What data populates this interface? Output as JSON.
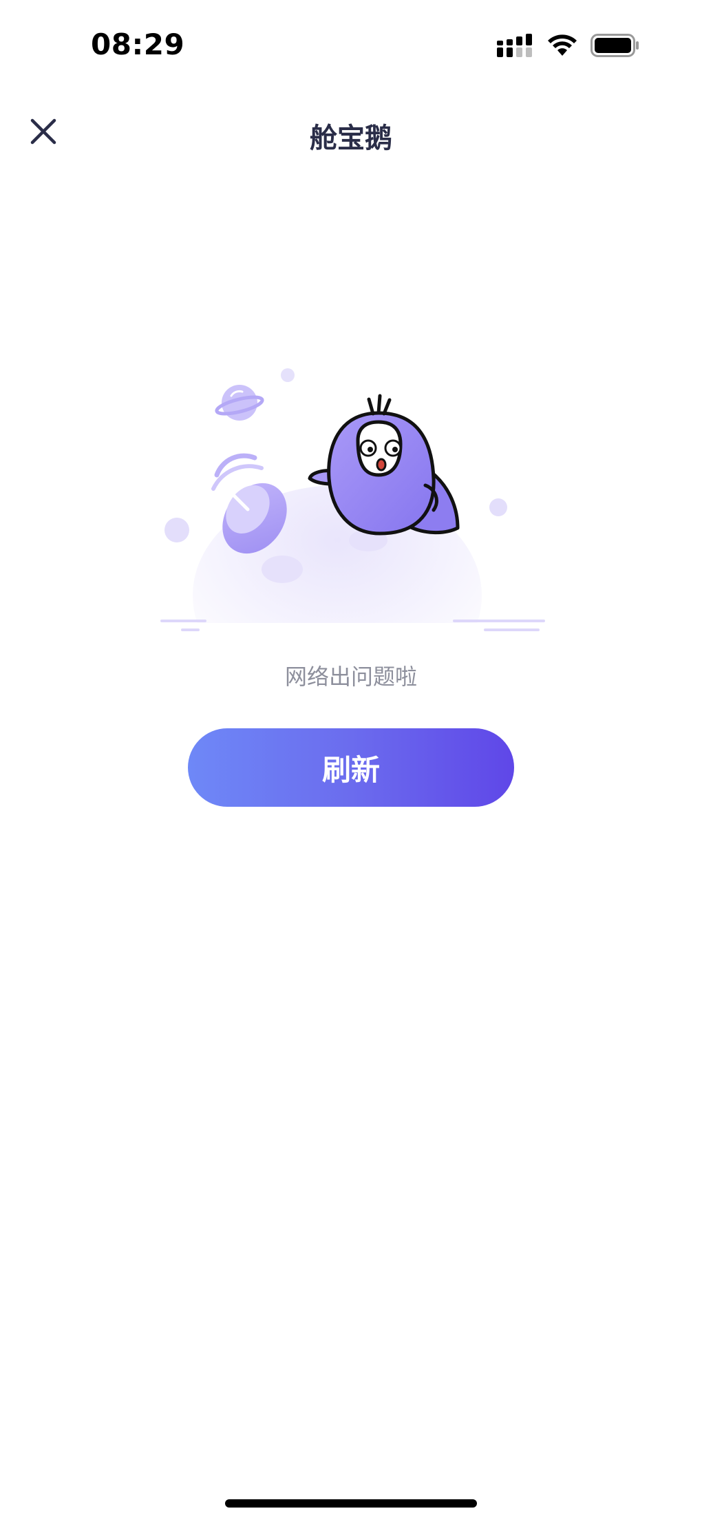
{
  "status_bar": {
    "time": "08:29",
    "icons": [
      "cellular-signal-icon",
      "wifi-icon",
      "battery-icon"
    ]
  },
  "nav": {
    "title": "舱宝鹅",
    "close_icon": "close-icon"
  },
  "illustration": {
    "name": "network-error-mascot",
    "colors": {
      "mascot_body": "#a18cf5",
      "accent": "#9a8ef0",
      "planet_bg": "#f1effd"
    }
  },
  "error": {
    "message": "网络出问题啦"
  },
  "actions": {
    "refresh_label": "刷新"
  },
  "theme": {
    "button_gradient_start": "#6e88f7",
    "button_gradient_end": "#5f47e8",
    "title_color": "#2a2d48",
    "message_color": "#8d8f9c"
  }
}
